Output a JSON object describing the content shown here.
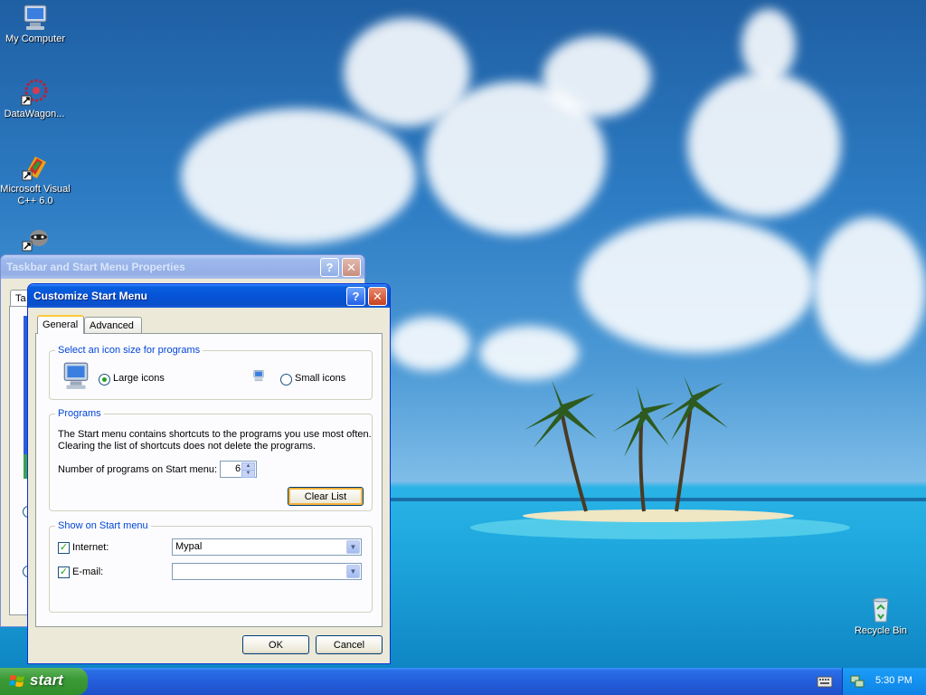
{
  "desktop": {
    "icons": [
      {
        "label": "My Computer",
        "icon": "my-computer-icon"
      },
      {
        "label": "DataWagon...",
        "icon": "datawagon-icon"
      },
      {
        "label": "Microsoft Visual C++ 6.0",
        "icon": "visual-cpp-icon"
      },
      {
        "label": "",
        "icon": "raccoon-icon"
      },
      {
        "label": "Recycle Bin",
        "icon": "recycle-bin-icon"
      }
    ]
  },
  "parent_window": {
    "title": "Taskbar and Start Menu Properties",
    "first_tab": "Ta",
    "help_label": "?",
    "close_label": "✕"
  },
  "dialog": {
    "title": "Customize Start Menu",
    "help_label": "?",
    "close_label": "✕",
    "tabs": [
      {
        "label": "General",
        "active": true
      },
      {
        "label": "Advanced",
        "active": false
      }
    ],
    "icon_size_group": {
      "label": "Select an icon size for programs",
      "large_label": "Large icons",
      "small_label": "Small icons",
      "selected": "large"
    },
    "programs_group": {
      "label": "Programs",
      "description_line1": "The Start menu contains shortcuts to the programs you use most often.",
      "description_line2": "Clearing the list of shortcuts does not delete the programs.",
      "count_label": "Number of programs on Start menu:",
      "count_value": "6",
      "clear_button": "Clear List"
    },
    "show_group": {
      "label": "Show on Start menu",
      "internet_label": "Internet:",
      "internet_checked": true,
      "internet_value": "Mypal",
      "email_label": "E-mail:",
      "email_checked": true,
      "email_value": ""
    },
    "ok_button": "OK",
    "cancel_button": "Cancel"
  },
  "taskbar": {
    "start_label": "start",
    "clock": "5:30 PM"
  },
  "colors": {
    "xp_blue": "#0553d6",
    "start_green": "#3c9a37",
    "group_label": "#0046d5"
  }
}
